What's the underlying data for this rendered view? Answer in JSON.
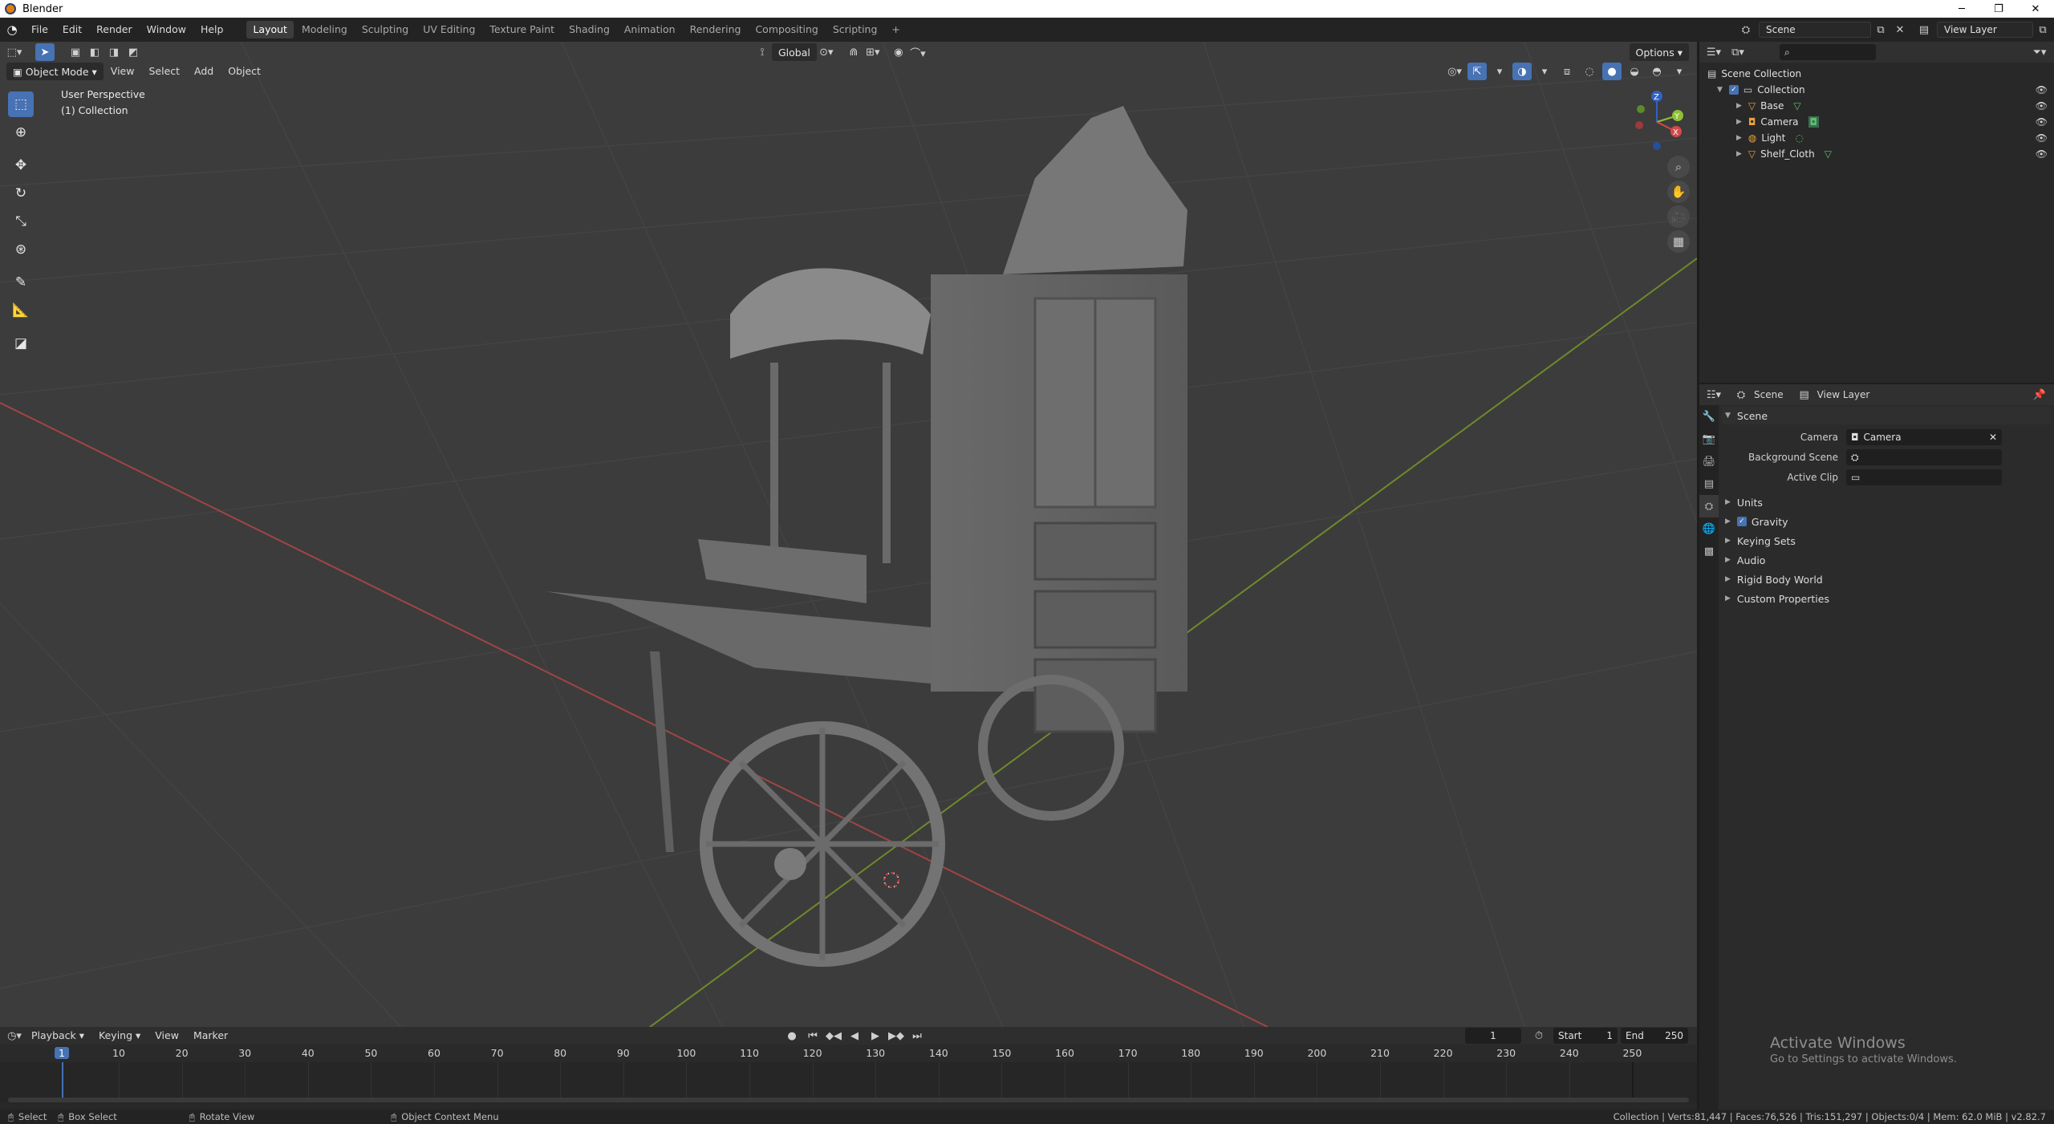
{
  "window": {
    "title": "Blender",
    "minimize": "─",
    "maximize": "❐",
    "close": "✕"
  },
  "menubar": {
    "items": [
      "File",
      "Edit",
      "Render",
      "Window",
      "Help"
    ]
  },
  "workspaces": [
    "Layout",
    "Modeling",
    "Sculpting",
    "UV Editing",
    "Texture Paint",
    "Shading",
    "Animation",
    "Rendering",
    "Compositing",
    "Scripting"
  ],
  "active_workspace": "Layout",
  "scene_selector": {
    "value": "Scene"
  },
  "viewlayer_selector": {
    "value": "View Layer"
  },
  "viewport": {
    "mode": "Object Mode",
    "menus": [
      "View",
      "Select",
      "Add",
      "Object"
    ],
    "orientation": "Global",
    "options_label": "Options",
    "overlay_line1": "User Perspective",
    "overlay_line2": "(1) Collection",
    "gizmo": {
      "x": "X",
      "y": "Y",
      "z": "Z"
    }
  },
  "outliner": {
    "root": "Scene Collection",
    "collection": "Collection",
    "objects": [
      {
        "name": "Base",
        "icon": "mesh-icon"
      },
      {
        "name": "Camera",
        "icon": "camera-icon"
      },
      {
        "name": "Light",
        "icon": "light-icon"
      },
      {
        "name": "Shelf_Cloth",
        "icon": "mesh-icon"
      }
    ]
  },
  "properties": {
    "breadcrumb_scene": "Scene",
    "breadcrumb_layer": "View Layer",
    "panel_title": "Scene",
    "fields": [
      {
        "label": "Camera",
        "value": "Camera"
      },
      {
        "label": "Background Scene",
        "value": ""
      },
      {
        "label": "Active Clip",
        "value": ""
      }
    ],
    "subpanels": [
      "Units",
      "Gravity",
      "Keying Sets",
      "Audio",
      "Rigid Body World",
      "Custom Properties"
    ],
    "gravity_checked": true
  },
  "timeline": {
    "menus": [
      "Playback",
      "Keying",
      "View",
      "Marker"
    ],
    "current_frame": "1",
    "start_label": "Start",
    "start": "1",
    "end_label": "End",
    "end": "250",
    "ticks": [
      "1",
      "10",
      "20",
      "30",
      "40",
      "50",
      "60",
      "70",
      "80",
      "90",
      "100",
      "110",
      "120",
      "130",
      "140",
      "150",
      "160",
      "170",
      "180",
      "190",
      "200",
      "210",
      "220",
      "230",
      "240",
      "250"
    ]
  },
  "statusbar": {
    "select": "Select",
    "box_select": "Box Select",
    "rotate_view": "Rotate View",
    "context_menu": "Object Context Menu",
    "stats": "Collection | Verts:81,447 | Faces:76,526 | Tris:151,297 | Objects:0/4 | Mem: 62.0 MiB | v2.82.7"
  },
  "watermark": {
    "title": "Activate Windows",
    "subtitle": "Go to Settings to activate Windows."
  },
  "colors": {
    "accent": "#4772b3",
    "viewport_bg": "#3c3c3c",
    "x_axis": "#b04848",
    "y_axis": "#7a9b2e"
  }
}
